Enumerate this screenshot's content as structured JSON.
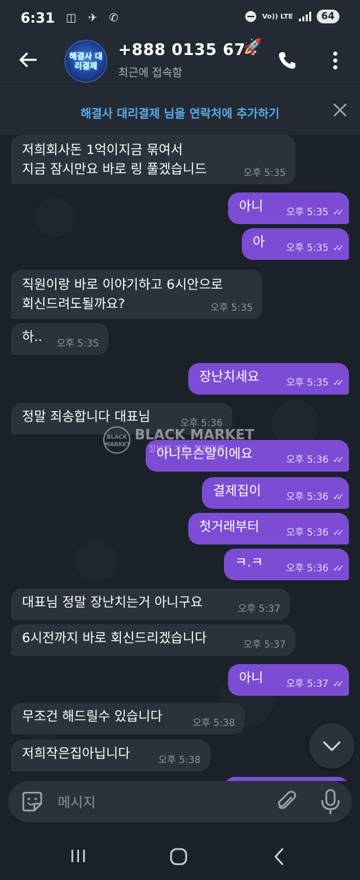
{
  "status_bar": {
    "time": "6:31",
    "left_icons": "◫ ✈ ✆",
    "volte": "Vo)) LTE",
    "lte": "LTE",
    "battery": "64"
  },
  "header": {
    "avatar_text": "해결사 대리결제",
    "contact_name": "+888 0135 674",
    "status": "최근에 접속함"
  },
  "banner": {
    "text": "해결사 대리결제 님을 연락처에 추가하기"
  },
  "messages": [
    {
      "dir": "in",
      "text": "저희회사돈 1억이지금 묶여서\n지금 잠시만요 바로 링 풀겠습니드",
      "time": "오후 5:35"
    },
    {
      "dir": "out",
      "text": "아니",
      "time": "오후 5:35"
    },
    {
      "dir": "out",
      "text": "아",
      "time": "오후 5:35"
    },
    {
      "dir": "in",
      "text": "직원이랑 바로 이야기하고 6시안으로\n회신드려도될까요?",
      "time": "오후 5:35"
    },
    {
      "dir": "in",
      "text": "하..",
      "time": "오후 5:35"
    },
    {
      "dir": "out",
      "text": "장난치세요",
      "time": "오후 5:35"
    },
    {
      "dir": "in",
      "text": "정말 죄송합니다 대표님",
      "time": "오후 5:36"
    },
    {
      "dir": "out",
      "text": "아니무슨말이에요",
      "time": "오후 5:36"
    },
    {
      "dir": "out",
      "text": "결제집이",
      "time": "오후 5:36"
    },
    {
      "dir": "out",
      "text": "첫거래부터",
      "time": "오후 5:36"
    },
    {
      "dir": "out",
      "text": "ㅋ.ㅋ",
      "time": "오후 5:36"
    },
    {
      "dir": "in",
      "text": "대표님 정말 장난치는거 아니구요",
      "time": "오후 5:37"
    },
    {
      "dir": "in",
      "text": "6시전까지 바로 회신드리겠습니다",
      "time": "오후 5:37"
    },
    {
      "dir": "out",
      "text": "아니",
      "time": "오후 5:37"
    },
    {
      "dir": "in",
      "text": "무조건 해드릴수 있습니다",
      "time": "오후 5:38"
    },
    {
      "dir": "in",
      "text": "저희작은집아닙니다",
      "time": "오후 5:38"
    }
  ],
  "watermark": {
    "badge": "BLACK MARKET",
    "title": "BLACK MARKET",
    "subtitle": "정보의 기준, 블랙마켓"
  },
  "composer": {
    "placeholder": "메시지"
  },
  "colors": {
    "incoming_bubble": "#2b323b",
    "outgoing_bubble": "#7c4dd4",
    "accent_link": "#5aa8e6",
    "background": "#1b2129"
  }
}
